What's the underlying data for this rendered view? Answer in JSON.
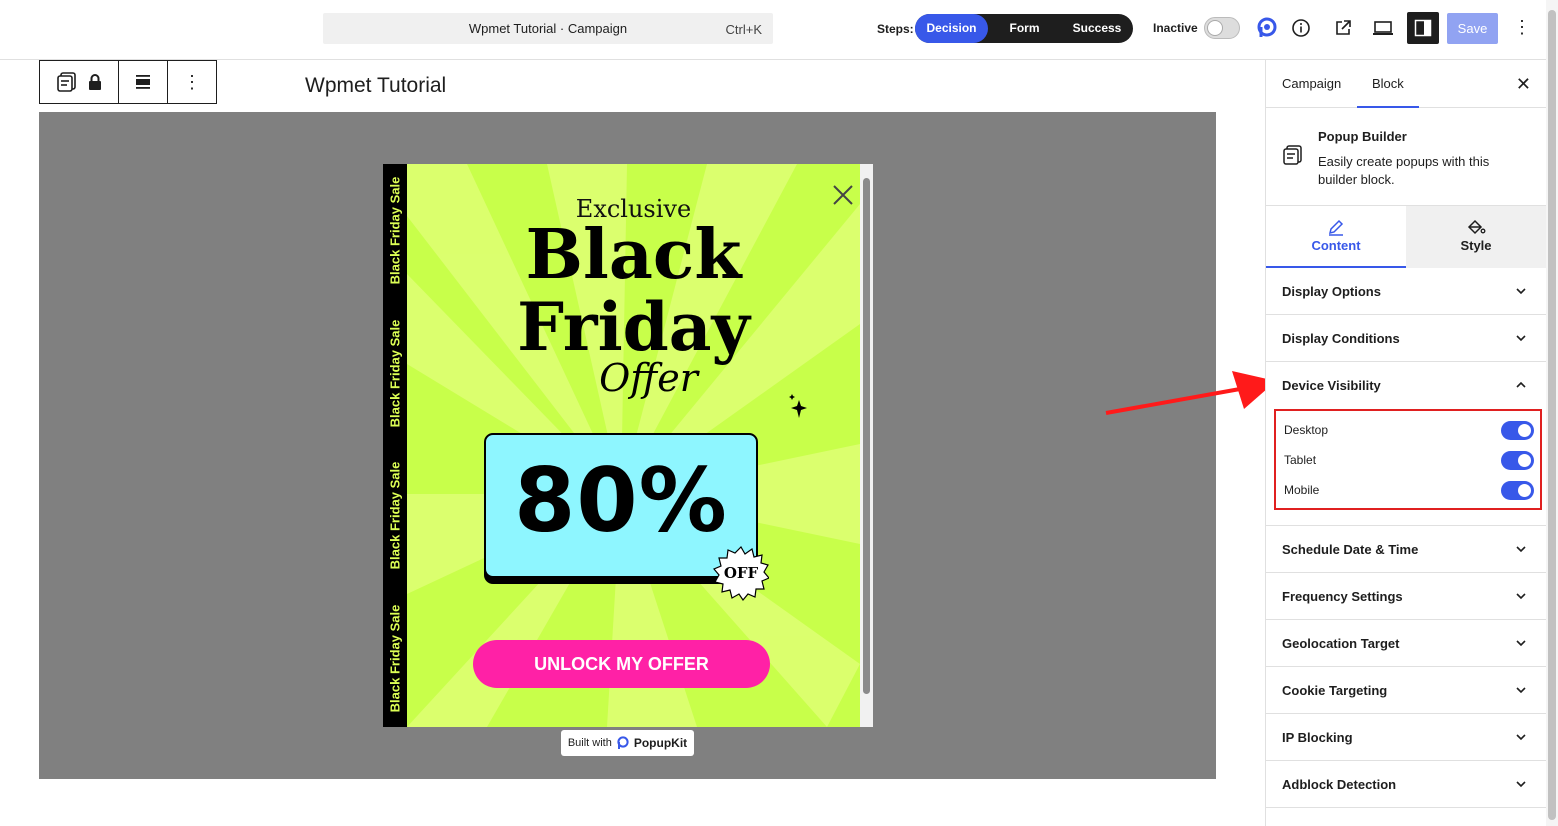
{
  "topbar": {
    "command_title": "Wpmet Tutorial · Campaign",
    "command_shortcut": "Ctrl+K",
    "steps_label": "Steps:",
    "steps": [
      "Decision",
      "Form",
      "Success"
    ],
    "status_label": "Inactive",
    "save_label": "Save",
    "accent_color": "#3858e9"
  },
  "document": {
    "title": "Wpmet Tutorial"
  },
  "popup": {
    "side_strip_text": [
      "Black Friday Sale",
      "Black Friday Sale",
      "Black Friday Sale",
      "Black Friday Sale"
    ],
    "heading_small": "Exclusive",
    "heading_line1": "Black",
    "heading_line2": "Friday",
    "heading_script": "Offer",
    "discount": "80%",
    "badge": "OFF",
    "cta_label": "UNLOCK MY OFFER",
    "cta_color": "#ff21a6",
    "background_color": "#c8ff4a",
    "built_with_prefix": "Built with",
    "built_with_brand": "PopupKit"
  },
  "panel": {
    "tabs": [
      "Campaign",
      "Block"
    ],
    "block_name": "Popup Builder",
    "block_description": "Easily create popups with this builder block.",
    "content_tabs": [
      "Content",
      "Style"
    ],
    "sections": [
      "Display Options",
      "Display Conditions",
      "Device Visibility",
      "Schedule Date & Time",
      "Frequency Settings",
      "Geolocation Target",
      "Cookie Targeting",
      "IP Blocking",
      "Adblock Detection"
    ],
    "device_visibility": [
      {
        "label": "Desktop",
        "enabled": true
      },
      {
        "label": "Tablet",
        "enabled": true
      },
      {
        "label": "Mobile",
        "enabled": true
      }
    ]
  }
}
